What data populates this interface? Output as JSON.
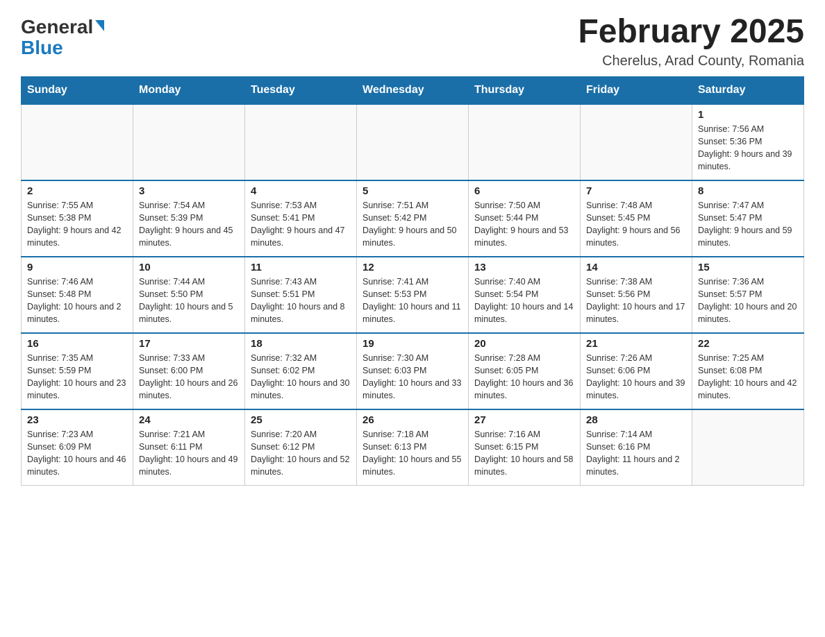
{
  "logo": {
    "line1": "General",
    "arrow": "▶",
    "line2": "Blue"
  },
  "header": {
    "title": "February 2025",
    "location": "Cherelus, Arad County, Romania"
  },
  "days_of_week": [
    "Sunday",
    "Monday",
    "Tuesday",
    "Wednesday",
    "Thursday",
    "Friday",
    "Saturday"
  ],
  "weeks": [
    [
      {
        "day": "",
        "info": ""
      },
      {
        "day": "",
        "info": ""
      },
      {
        "day": "",
        "info": ""
      },
      {
        "day": "",
        "info": ""
      },
      {
        "day": "",
        "info": ""
      },
      {
        "day": "",
        "info": ""
      },
      {
        "day": "1",
        "info": "Sunrise: 7:56 AM\nSunset: 5:36 PM\nDaylight: 9 hours and 39 minutes."
      }
    ],
    [
      {
        "day": "2",
        "info": "Sunrise: 7:55 AM\nSunset: 5:38 PM\nDaylight: 9 hours and 42 minutes."
      },
      {
        "day": "3",
        "info": "Sunrise: 7:54 AM\nSunset: 5:39 PM\nDaylight: 9 hours and 45 minutes."
      },
      {
        "day": "4",
        "info": "Sunrise: 7:53 AM\nSunset: 5:41 PM\nDaylight: 9 hours and 47 minutes."
      },
      {
        "day": "5",
        "info": "Sunrise: 7:51 AM\nSunset: 5:42 PM\nDaylight: 9 hours and 50 minutes."
      },
      {
        "day": "6",
        "info": "Sunrise: 7:50 AM\nSunset: 5:44 PM\nDaylight: 9 hours and 53 minutes."
      },
      {
        "day": "7",
        "info": "Sunrise: 7:48 AM\nSunset: 5:45 PM\nDaylight: 9 hours and 56 minutes."
      },
      {
        "day": "8",
        "info": "Sunrise: 7:47 AM\nSunset: 5:47 PM\nDaylight: 9 hours and 59 minutes."
      }
    ],
    [
      {
        "day": "9",
        "info": "Sunrise: 7:46 AM\nSunset: 5:48 PM\nDaylight: 10 hours and 2 minutes."
      },
      {
        "day": "10",
        "info": "Sunrise: 7:44 AM\nSunset: 5:50 PM\nDaylight: 10 hours and 5 minutes."
      },
      {
        "day": "11",
        "info": "Sunrise: 7:43 AM\nSunset: 5:51 PM\nDaylight: 10 hours and 8 minutes."
      },
      {
        "day": "12",
        "info": "Sunrise: 7:41 AM\nSunset: 5:53 PM\nDaylight: 10 hours and 11 minutes."
      },
      {
        "day": "13",
        "info": "Sunrise: 7:40 AM\nSunset: 5:54 PM\nDaylight: 10 hours and 14 minutes."
      },
      {
        "day": "14",
        "info": "Sunrise: 7:38 AM\nSunset: 5:56 PM\nDaylight: 10 hours and 17 minutes."
      },
      {
        "day": "15",
        "info": "Sunrise: 7:36 AM\nSunset: 5:57 PM\nDaylight: 10 hours and 20 minutes."
      }
    ],
    [
      {
        "day": "16",
        "info": "Sunrise: 7:35 AM\nSunset: 5:59 PM\nDaylight: 10 hours and 23 minutes."
      },
      {
        "day": "17",
        "info": "Sunrise: 7:33 AM\nSunset: 6:00 PM\nDaylight: 10 hours and 26 minutes."
      },
      {
        "day": "18",
        "info": "Sunrise: 7:32 AM\nSunset: 6:02 PM\nDaylight: 10 hours and 30 minutes."
      },
      {
        "day": "19",
        "info": "Sunrise: 7:30 AM\nSunset: 6:03 PM\nDaylight: 10 hours and 33 minutes."
      },
      {
        "day": "20",
        "info": "Sunrise: 7:28 AM\nSunset: 6:05 PM\nDaylight: 10 hours and 36 minutes."
      },
      {
        "day": "21",
        "info": "Sunrise: 7:26 AM\nSunset: 6:06 PM\nDaylight: 10 hours and 39 minutes."
      },
      {
        "day": "22",
        "info": "Sunrise: 7:25 AM\nSunset: 6:08 PM\nDaylight: 10 hours and 42 minutes."
      }
    ],
    [
      {
        "day": "23",
        "info": "Sunrise: 7:23 AM\nSunset: 6:09 PM\nDaylight: 10 hours and 46 minutes."
      },
      {
        "day": "24",
        "info": "Sunrise: 7:21 AM\nSunset: 6:11 PM\nDaylight: 10 hours and 49 minutes."
      },
      {
        "day": "25",
        "info": "Sunrise: 7:20 AM\nSunset: 6:12 PM\nDaylight: 10 hours and 52 minutes."
      },
      {
        "day": "26",
        "info": "Sunrise: 7:18 AM\nSunset: 6:13 PM\nDaylight: 10 hours and 55 minutes."
      },
      {
        "day": "27",
        "info": "Sunrise: 7:16 AM\nSunset: 6:15 PM\nDaylight: 10 hours and 58 minutes."
      },
      {
        "day": "28",
        "info": "Sunrise: 7:14 AM\nSunset: 6:16 PM\nDaylight: 11 hours and 2 minutes."
      },
      {
        "day": "",
        "info": ""
      }
    ]
  ]
}
